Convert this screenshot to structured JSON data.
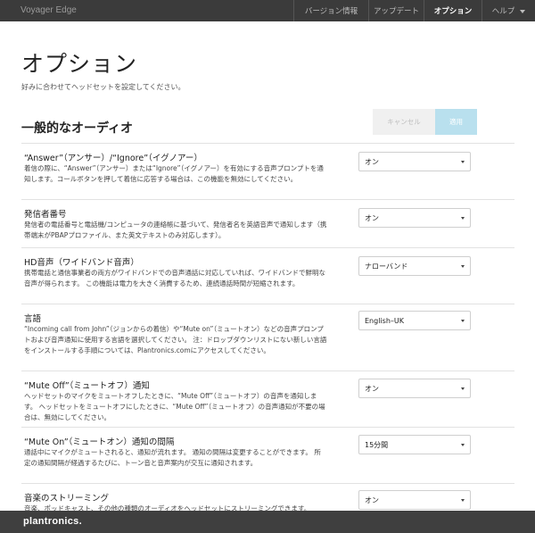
{
  "app": {
    "title": "Voyager Edge"
  },
  "nav": {
    "items": [
      {
        "label": "バージョン情報"
      },
      {
        "label": "アップデート"
      },
      {
        "label": "オプション"
      },
      {
        "label": "ヘルプ"
      }
    ],
    "active": "オプション"
  },
  "page": {
    "title": "オプション",
    "subtitle": "好みに合わせてヘッドセットを設定してください。"
  },
  "section": {
    "title": "一般的なオーディオ",
    "cancel_label": "キャンセル",
    "apply_label": "適用"
  },
  "settings": [
    {
      "label": "“Answer”（アンサー）/“Ignore”（イグノアー）",
      "desc": "着信の際に、“Answer”（アンサー）または“Ignore”（イグノアー）を有効にする音声プロンプトを通知します。コールボタンを押して着信に応答する場合は、この機能を無効にしてください。",
      "value": "オン"
    },
    {
      "label": "発信者番号",
      "desc": "発信者の電話番号と電話機/コンピュータの連絡帳に基づいて、発信者名を英語音声で通知します（携帯端末がPBAPプロファイル、また英文テキストのみ対応します）。",
      "value": "オン"
    },
    {
      "label": "HD音声（ワイドバンド音声）",
      "desc": "携帯電話と通信事業者の両方がワイドバンドでの音声通話に対応していれば、ワイドバンドで鮮明な音声が得られます。 この機能は電力を大きく消費するため、連続通話時間が短縮されます。",
      "value": "ナローバンド"
    },
    {
      "label": "言語",
      "desc": "“Incoming call from John”（ジョンからの着信）や“Mute on”（ミュートオン）などの音声プロンプトおよび音声通知に使用する言語を選択してください。 注：ドロップダウンリストにない新しい言語をインストールする手順については、Plantronics.comにアクセスしてください。",
      "value": "English–UK"
    },
    {
      "label": "“Mute Off”（ミュートオフ）通知",
      "desc": "ヘッドセットのマイクをミュートオフしたときに、“Mute Off”（ミュートオフ）の音声を通知します。 ヘッドセットをミュートオフにしたときに、“Mute Off”（ミュートオフ）の音声通知が不要の場合は、無効にしてください。",
      "value": "オン"
    },
    {
      "label": "“Mute On”（ミュートオン）通知の間隔",
      "desc": "通話中にマイクがミュートされると、通知が流れます。 通知の間隔は変更することができます。 所定の通知間隔が経過するたびに、トーン音と音声案内が交互に通知されます。",
      "value": "15分間"
    },
    {
      "label": "音楽のストリーミング",
      "desc": "音楽、ポッドキャスト、その他の種類のオーディオをヘッドセットにストリーミングできます。",
      "value": "オン"
    }
  ],
  "footer": {
    "logo": "plantronics."
  }
}
